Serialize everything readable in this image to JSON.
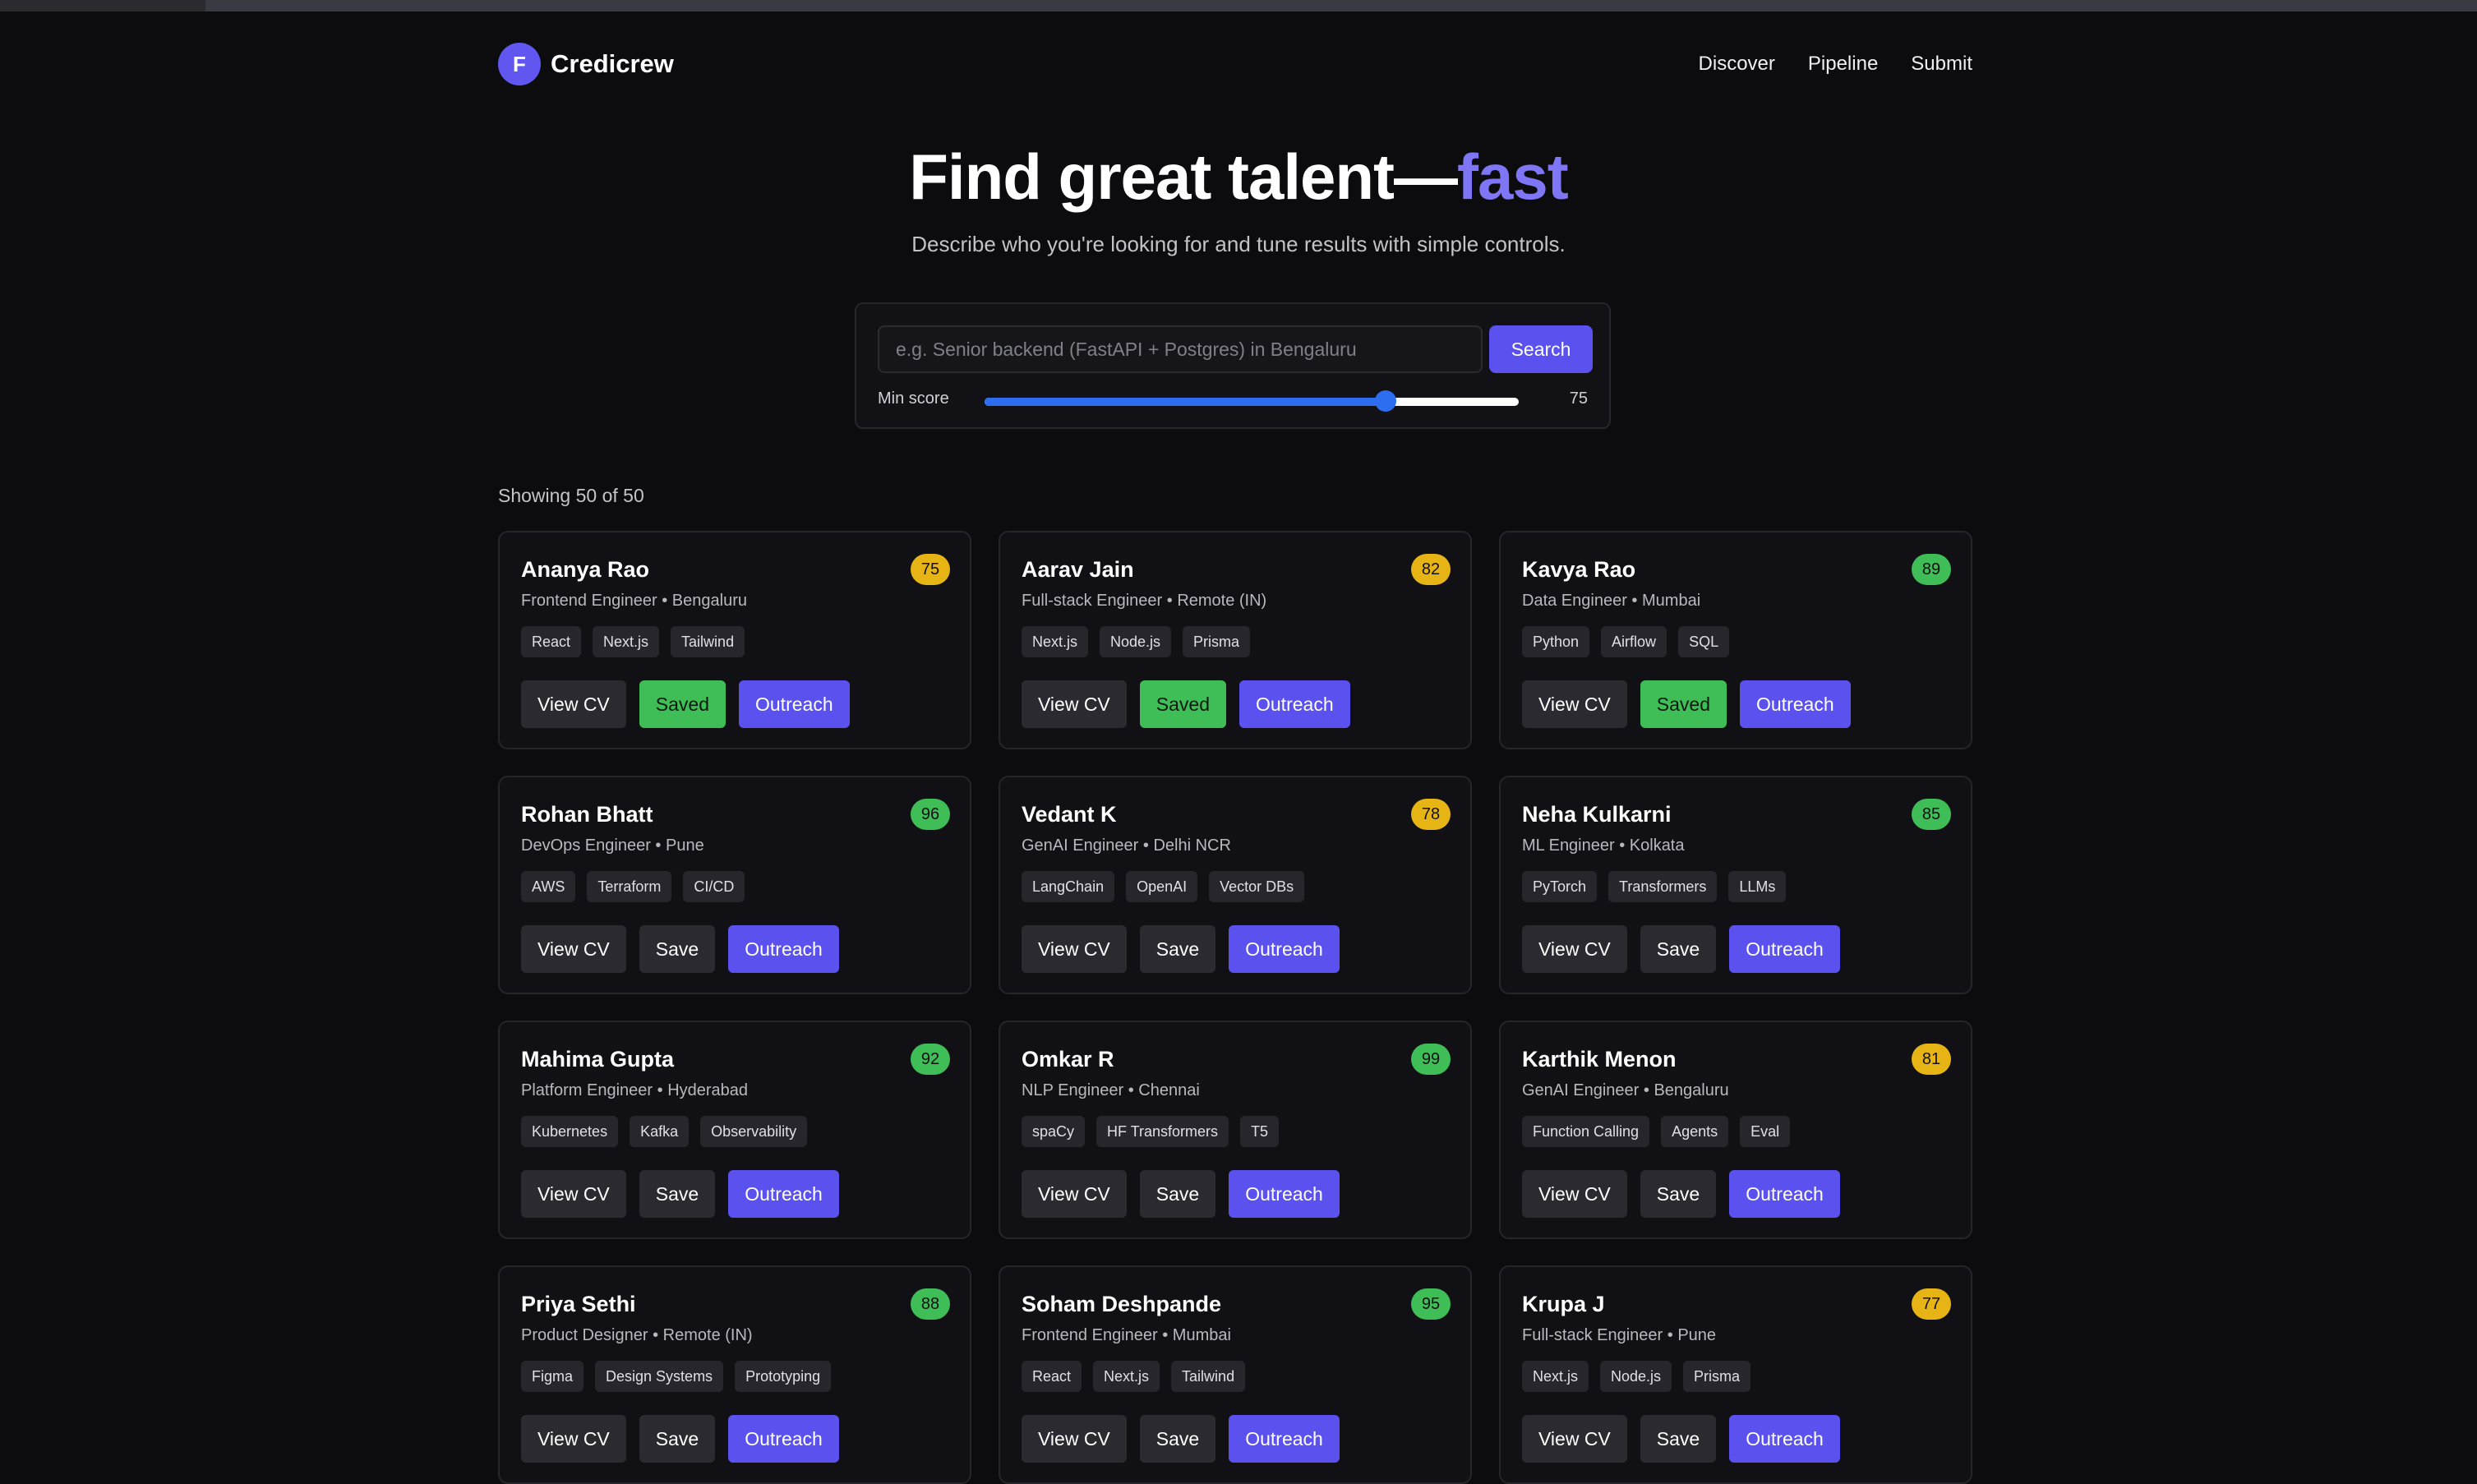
{
  "app": {
    "logo_letter": "F",
    "brand": "Credicrew"
  },
  "nav": {
    "items": [
      "Discover",
      "Pipeline",
      "Submit"
    ]
  },
  "hero": {
    "title_main": "Find great talent—",
    "title_accent": "fast",
    "subtitle": "Describe who you're looking for and tune results with simple controls."
  },
  "search": {
    "placeholder": "e.g. Senior backend (FastAPI + Postgres) in Bengaluru",
    "value": "",
    "button_label": "Search",
    "min_score_label": "Min score",
    "min_score_value": "75",
    "min_score_fraction": 0.75
  },
  "results": {
    "showing": "Showing 50 of 50"
  },
  "labels": {
    "view_cv": "View CV",
    "save": "Save",
    "saved": "Saved",
    "outreach": "Outreach"
  },
  "colors": {
    "score_high": "#3fbd57",
    "score_mid": "#e6b414",
    "accent": "#7e76f5",
    "primary_button": "#5a51ee"
  },
  "candidates": [
    {
      "name": "Ananya Rao",
      "role": "Frontend Engineer",
      "location": "Bengaluru",
      "score": "75",
      "tags": [
        "React",
        "Next.js",
        "Tailwind"
      ],
      "saved": true
    },
    {
      "name": "Aarav Jain",
      "role": "Full-stack Engineer",
      "location": "Remote (IN)",
      "score": "82",
      "tags": [
        "Next.js",
        "Node.js",
        "Prisma"
      ],
      "saved": true
    },
    {
      "name": "Kavya Rao",
      "role": "Data Engineer",
      "location": "Mumbai",
      "score": "89",
      "tags": [
        "Python",
        "Airflow",
        "SQL"
      ],
      "saved": true
    },
    {
      "name": "Rohan Bhatt",
      "role": "DevOps Engineer",
      "location": "Pune",
      "score": "96",
      "tags": [
        "AWS",
        "Terraform",
        "CI/CD"
      ],
      "saved": false
    },
    {
      "name": "Vedant K",
      "role": "GenAI Engineer",
      "location": "Delhi NCR",
      "score": "78",
      "tags": [
        "LangChain",
        "OpenAI",
        "Vector DBs"
      ],
      "saved": false
    },
    {
      "name": "Neha Kulkarni",
      "role": "ML Engineer",
      "location": "Kolkata",
      "score": "85",
      "tags": [
        "PyTorch",
        "Transformers",
        "LLMs"
      ],
      "saved": false
    },
    {
      "name": "Mahima Gupta",
      "role": "Platform Engineer",
      "location": "Hyderabad",
      "score": "92",
      "tags": [
        "Kubernetes",
        "Kafka",
        "Observability"
      ],
      "saved": false
    },
    {
      "name": "Omkar R",
      "role": "NLP Engineer",
      "location": "Chennai",
      "score": "99",
      "tags": [
        "spaCy",
        "HF Transformers",
        "T5"
      ],
      "saved": false
    },
    {
      "name": "Karthik Menon",
      "role": "GenAI Engineer",
      "location": "Bengaluru",
      "score": "81",
      "tags": [
        "Function Calling",
        "Agents",
        "Eval"
      ],
      "saved": false
    },
    {
      "name": "Priya Sethi",
      "role": "Product Designer",
      "location": "Remote (IN)",
      "score": "88",
      "tags": [
        "Figma",
        "Design Systems",
        "Prototyping"
      ],
      "saved": false
    },
    {
      "name": "Soham Deshpande",
      "role": "Frontend Engineer",
      "location": "Mumbai",
      "score": "95",
      "tags": [
        "React",
        "Next.js",
        "Tailwind"
      ],
      "saved": false
    },
    {
      "name": "Krupa J",
      "role": "Full-stack Engineer",
      "location": "Pune",
      "score": "77",
      "tags": [
        "Next.js",
        "Node.js",
        "Prisma"
      ],
      "saved": false
    }
  ]
}
